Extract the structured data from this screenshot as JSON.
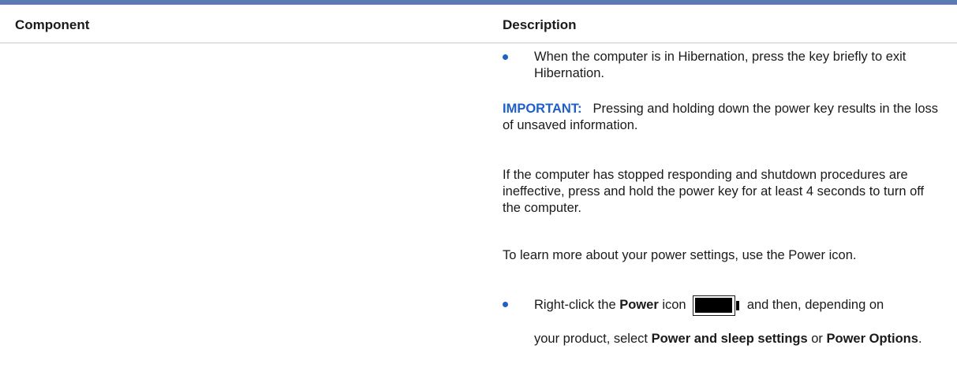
{
  "table": {
    "header": {
      "component": "Component",
      "description": "Description"
    },
    "row": {
      "bullet1": "When the computer is in Hibernation, press the key briefly to exit Hibernation.",
      "important_label": "IMPORTANT:",
      "important_text": "Pressing and holding down the power key results in the loss of unsaved information.",
      "para_stopped": "If the computer has stopped responding and shutdown procedures are ineffective, press and hold the power key for at least 4 seconds to turn off the computer.",
      "para_learn": "To learn more about your power settings, use the Power icon.",
      "bullet2": {
        "pre": "Right-click the",
        "power": "Power",
        "icon_word": "icon",
        "icon_name": "battery-power-icon",
        "post": "and then, depending on",
        "line2_pre": "your product, select",
        "option1": "Power and sleep settings",
        "or": "or",
        "option2": "Power Options",
        "end": "."
      }
    }
  },
  "colors": {
    "accent": "#1f5fc8",
    "top_rule": "#5b7bb2",
    "divider": "#c9c9c9"
  }
}
